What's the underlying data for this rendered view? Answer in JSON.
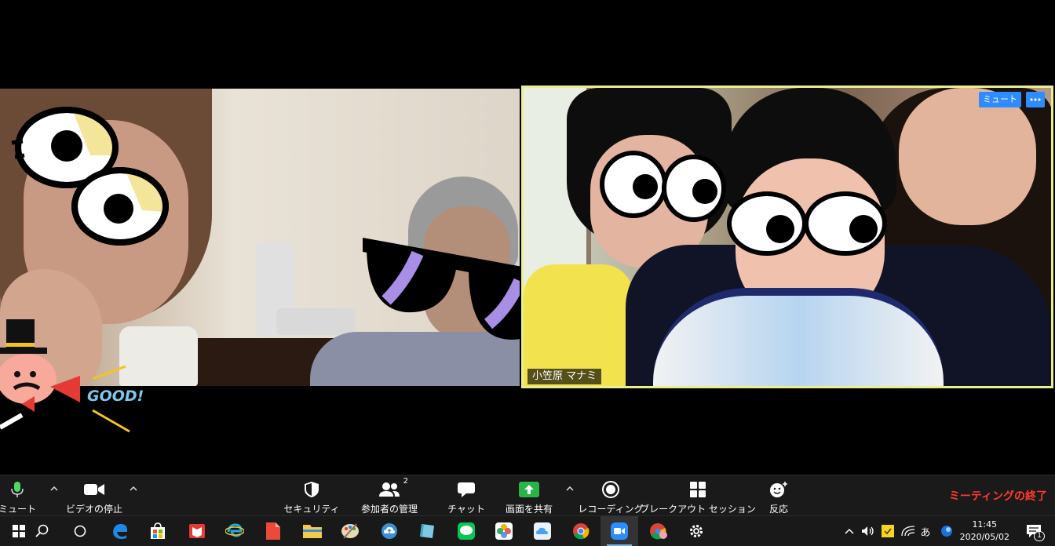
{
  "participants": {
    "left": {
      "name": ""
    },
    "right": {
      "name": "小笠原 マナミ",
      "mute_label": "ミュート"
    }
  },
  "stickers": {
    "good": "GOOD!"
  },
  "toolbar": {
    "mute": "ミュート",
    "video_stop": "ビデオの停止",
    "security": "セキュリティ",
    "participants": "参加者の管理",
    "participants_count": "2",
    "chat": "チャット",
    "share_screen": "画面を共有",
    "recording": "レコーディング",
    "breakout": "ブレークアウト セッション",
    "reactions": "反応",
    "end_meeting": "ミーティングの終了"
  },
  "taskbar": {
    "ime": "あ",
    "time": "11:45",
    "date": "2020/05/02",
    "notification_count": "1"
  },
  "colors": {
    "active_speaker_border": "#e9ef8c",
    "zoom_blue": "#2d8cff",
    "share_green": "#28b446",
    "end_red": "#ff3b30",
    "mic_green": "#4cd964"
  }
}
